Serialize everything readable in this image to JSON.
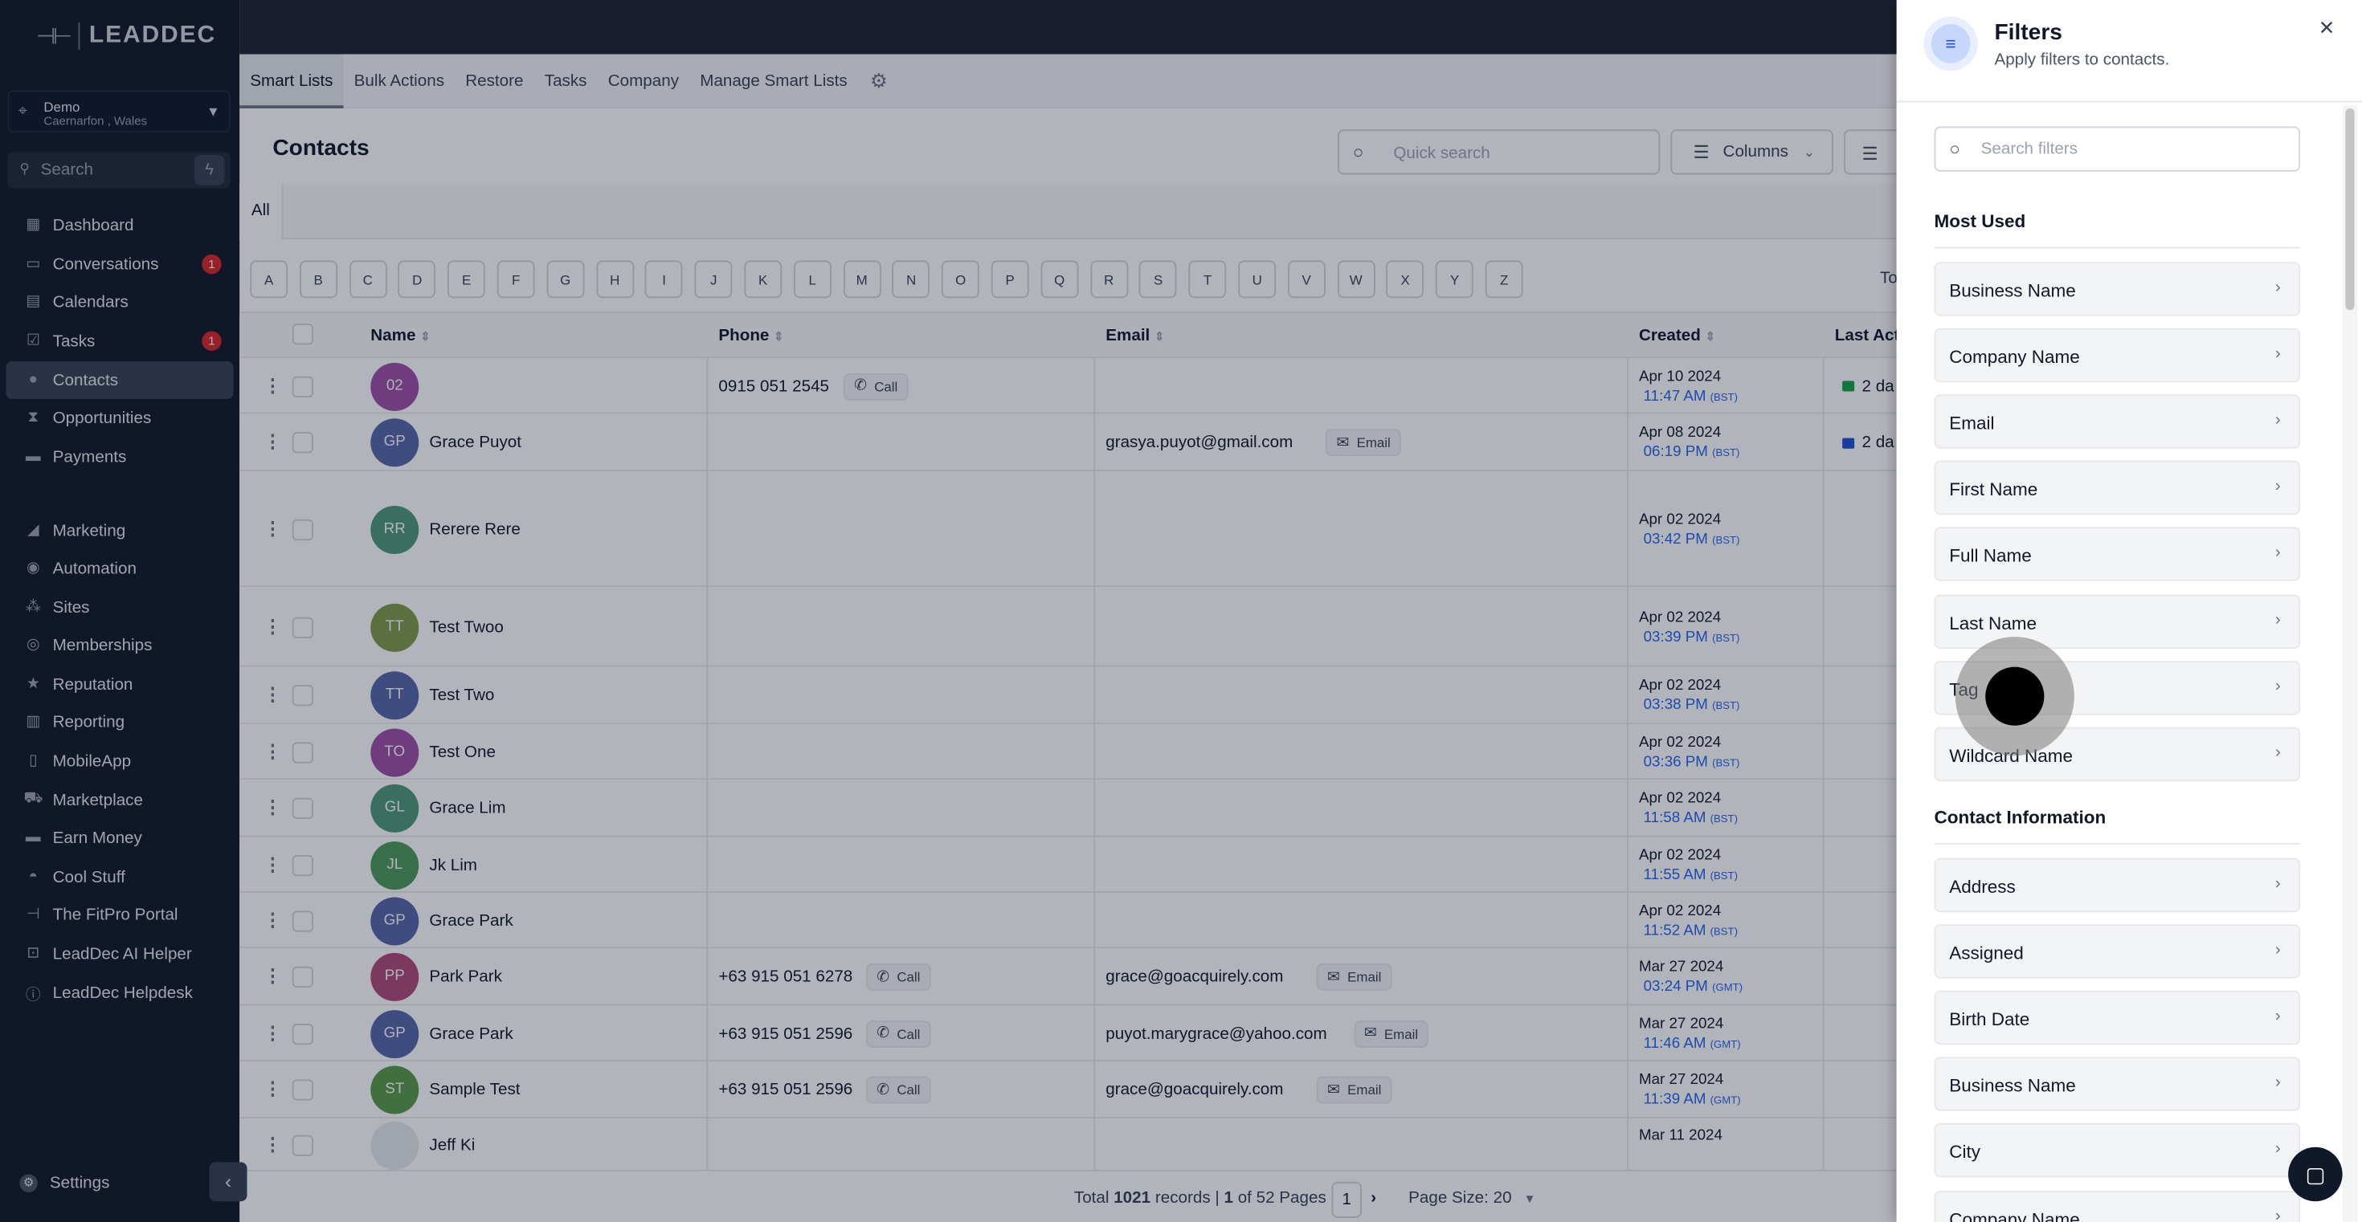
{
  "app": {
    "logo_text": "LEADDEC",
    "logo_mark": "⊣⊢"
  },
  "location": {
    "name": "Demo",
    "address": "Caernarfon , Wales"
  },
  "sidebar": {
    "search_placeholder": "Search",
    "items": [
      {
        "label": "Dashboard",
        "icon": "dashboard-icon"
      },
      {
        "label": "Conversations",
        "icon": "chat-icon",
        "badge": "1"
      },
      {
        "label": "Calendars",
        "icon": "calendar-icon"
      },
      {
        "label": "Tasks",
        "icon": "check-icon",
        "badge": "1"
      },
      {
        "label": "Contacts",
        "icon": "person-icon",
        "active": true
      },
      {
        "label": "Opportunities",
        "icon": "funnel-icon"
      },
      {
        "label": "Payments",
        "icon": "card-icon"
      },
      {
        "label": "Marketing",
        "icon": "megaphone-icon"
      },
      {
        "label": "Automation",
        "icon": "automation-icon"
      },
      {
        "label": "Sites",
        "icon": "sites-icon"
      },
      {
        "label": "Memberships",
        "icon": "members-icon"
      },
      {
        "label": "Reputation",
        "icon": "star-icon"
      },
      {
        "label": "Reporting",
        "icon": "chart-icon"
      },
      {
        "label": "MobileApp",
        "icon": "phone-icon"
      },
      {
        "label": "Marketplace",
        "icon": "cart-icon"
      },
      {
        "label": "Earn Money",
        "icon": "money-icon"
      },
      {
        "label": "Cool Stuff",
        "icon": "flame-icon"
      },
      {
        "label": "The FitPro Portal",
        "icon": "dumbbell-icon"
      },
      {
        "label": "LeadDec AI Helper",
        "icon": "robot-icon"
      },
      {
        "label": "LeadDec Helpdesk",
        "icon": "info-icon"
      }
    ],
    "settings_label": "Settings"
  },
  "subnav": {
    "tabs": [
      "Smart Lists",
      "Bulk Actions",
      "Restore",
      "Tasks",
      "Company",
      "Manage Smart Lists"
    ]
  },
  "contacts": {
    "title": "Contacts",
    "quick_search_placeholder": "Quick search",
    "columns_label": "Columns",
    "tab_all": "All",
    "alphabet": [
      "A",
      "B",
      "C",
      "D",
      "E",
      "F",
      "G",
      "H",
      "I",
      "J",
      "K",
      "L",
      "M",
      "N",
      "O",
      "P",
      "Q",
      "R",
      "S",
      "T",
      "U",
      "V",
      "W",
      "X",
      "Y",
      "Z"
    ],
    "total_label": "To",
    "headers": {
      "name": "Name",
      "phone": "Phone",
      "email": "Email",
      "created": "Created",
      "last_activity": "Last Acti"
    },
    "rows": [
      {
        "initials": "02",
        "color": "#9d4fa8",
        "name": "",
        "phone": "0915 051 2545",
        "phone_btn": "Call",
        "email": "",
        "email_btn": "",
        "created_date": "Apr 10 2024",
        "created_time": "11:47 AM",
        "tz": "(BST)",
        "last": "2 da",
        "last_color": "#16a34a"
      },
      {
        "initials": "GP",
        "color": "#5566a8",
        "name": "Grace Puyot",
        "phone": "",
        "phone_btn": "",
        "email": "grasya.puyot@gmail.com",
        "email_btn": "Email",
        "created_date": "Apr 08 2024",
        "created_time": "06:19 PM",
        "tz": "(BST)",
        "last": "2 da",
        "last_color": "#1d4ed8"
      },
      {
        "initials": "RR",
        "color": "#4f9a7a",
        "name": "Rerere Rere",
        "phone": "",
        "phone_btn": "",
        "email": "",
        "email_btn": "",
        "created_date": "Apr 02 2024",
        "created_time": "03:42 PM",
        "tz": "(BST)",
        "last": "",
        "last_color": ""
      },
      {
        "initials": "TT",
        "color": "#7f9a4a",
        "name": "Test Twoo",
        "phone": "",
        "phone_btn": "",
        "email": "",
        "email_btn": "",
        "created_date": "Apr 02 2024",
        "created_time": "03:39 PM",
        "tz": "(BST)",
        "last": "",
        "last_color": ""
      },
      {
        "initials": "TT",
        "color": "#5566a8",
        "name": "Test Two",
        "phone": "",
        "phone_btn": "",
        "email": "",
        "email_btn": "",
        "created_date": "Apr 02 2024",
        "created_time": "03:38 PM",
        "tz": "(BST)",
        "last": "",
        "last_color": ""
      },
      {
        "initials": "TO",
        "color": "#9d4fa8",
        "name": "Test One",
        "phone": "",
        "phone_btn": "",
        "email": "",
        "email_btn": "",
        "created_date": "Apr 02 2024",
        "created_time": "03:36 PM",
        "tz": "(BST)",
        "last": "",
        "last_color": ""
      },
      {
        "initials": "GL",
        "color": "#4f9a7a",
        "name": "Grace Lim",
        "phone": "",
        "phone_btn": "",
        "email": "",
        "email_btn": "",
        "created_date": "Apr 02 2024",
        "created_time": "11:58 AM",
        "tz": "(BST)",
        "last": "",
        "last_color": ""
      },
      {
        "initials": "JL",
        "color": "#4f9a5a",
        "name": "Jk Lim",
        "phone": "",
        "phone_btn": "",
        "email": "",
        "email_btn": "",
        "created_date": "Apr 02 2024",
        "created_time": "11:55 AM",
        "tz": "(BST)",
        "last": "",
        "last_color": ""
      },
      {
        "initials": "GP",
        "color": "#5566a8",
        "name": "Grace Park",
        "phone": "",
        "phone_btn": "",
        "email": "",
        "email_btn": "",
        "created_date": "Apr 02 2024",
        "created_time": "11:52 AM",
        "tz": "(BST)",
        "last": "",
        "last_color": ""
      },
      {
        "initials": "PP",
        "color": "#b04a7a",
        "name": "Park Park",
        "phone": "+63 915 051 6278",
        "phone_btn": "Call",
        "email": "grace@goacquirely.com",
        "email_btn": "Email",
        "created_date": "Mar 27 2024",
        "created_time": "03:24 PM",
        "tz": "(GMT)",
        "last": "",
        "last_color": ""
      },
      {
        "initials": "GP",
        "color": "#5566a8",
        "name": "Grace Park",
        "phone": "+63 915 051 2596",
        "phone_btn": "Call",
        "email": "puyot.marygrace@yahoo.com",
        "email_btn": "Email",
        "created_date": "Mar 27 2024",
        "created_time": "11:46 AM",
        "tz": "(GMT)",
        "last": "",
        "last_color": ""
      },
      {
        "initials": "ST",
        "color": "#5a9a4a",
        "name": "Sample Test",
        "phone": "+63 915 051 2596",
        "phone_btn": "Call",
        "email": "grace@goacquirely.com",
        "email_btn": "Email",
        "created_date": "Mar 27 2024",
        "created_time": "11:39 AM",
        "tz": "(GMT)",
        "last": "",
        "last_color": ""
      },
      {
        "initials": "",
        "color": "#e5e7eb",
        "name": "Jeff Ki",
        "phone": "",
        "phone_btn": "",
        "email": "",
        "email_btn": "",
        "created_date": "Mar 11 2024",
        "created_time": "",
        "tz": "",
        "last": "",
        "last_color": ""
      }
    ],
    "footer": {
      "total_prefix": "Total",
      "total_records": "1021",
      "records_word": "records |",
      "page_current": "1",
      "of_pages": "of 52 Pages",
      "page_box": "1",
      "page_size": "Page Size: 20"
    }
  },
  "filters": {
    "title": "Filters",
    "subtitle": "Apply filters to contacts.",
    "search_placeholder": "Search filters",
    "sections": [
      {
        "title": "Most Used",
        "items": [
          "Business Name",
          "Company Name",
          "Email",
          "First Name",
          "Full Name",
          "Last Name",
          "Tag",
          "Wildcard Name"
        ]
      },
      {
        "title": "Contact Information",
        "items": [
          "Address",
          "Assigned",
          "Birth Date",
          "Business Name",
          "City",
          "Company Name"
        ]
      }
    ]
  }
}
